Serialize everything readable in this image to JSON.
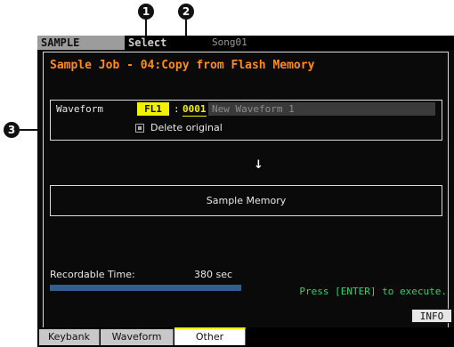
{
  "callouts": [
    "1",
    "2",
    "3"
  ],
  "header": {
    "mode": "SAMPLE",
    "screen": "Select",
    "song": "Song01"
  },
  "job": {
    "title": "Sample Job - 04:Copy from Flash Memory"
  },
  "waveform": {
    "label": "Waveform",
    "bank": "FL1",
    "separator": ":",
    "number": "0001",
    "name": "New Waveform 1",
    "delete_original_label": "Delete original",
    "delete_original_checked": false
  },
  "arrow": "↓",
  "destination": {
    "label": "Sample Memory"
  },
  "recordable": {
    "label": "Recordable Time:",
    "value": "380 sec",
    "level": 1.0
  },
  "status": {
    "prompt": "Press [ENTER] to execute."
  },
  "buttons": {
    "info": "INFO"
  },
  "bottom_tabs": [
    {
      "label": "Keybank",
      "active": false
    },
    {
      "label": "Waveform",
      "active": false
    },
    {
      "label": "Other",
      "active": true
    }
  ],
  "colors": {
    "accent_title": "#ff8a1a",
    "highlight": "#f2f200",
    "prompt": "#2fd36b",
    "bar": "#2f5f8f"
  }
}
